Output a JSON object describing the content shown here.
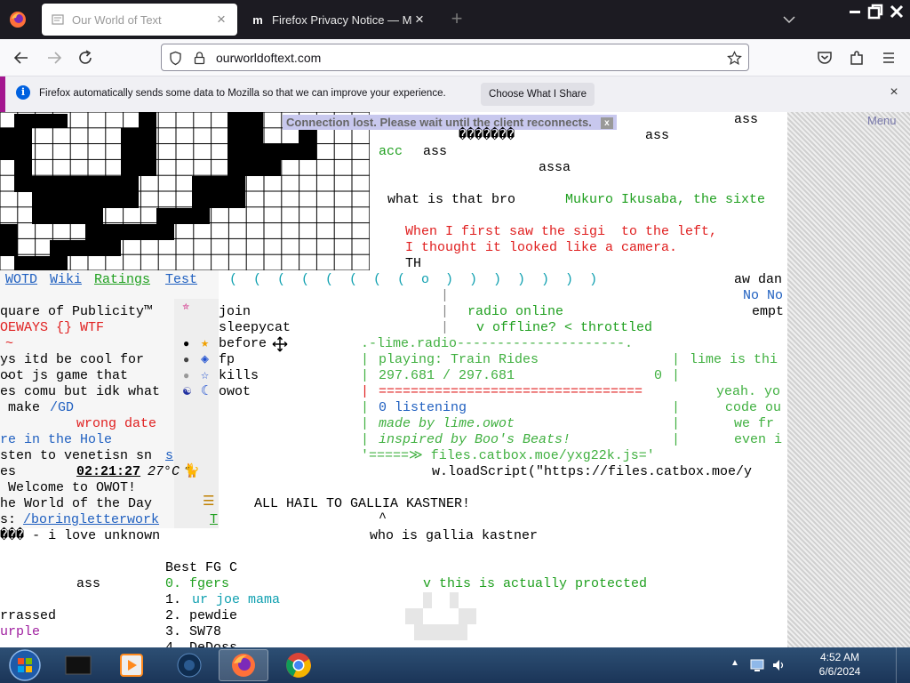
{
  "browser": {
    "tabs": [
      {
        "title": "Our World of Text",
        "active": true
      },
      {
        "title": "Firefox Privacy Notice — Mozilla",
        "active": false
      }
    ],
    "url": "ourworldoftext.com"
  },
  "notification": {
    "message": "Firefox automatically sends some data to Mozilla so that we can improve your experience.",
    "button": "Choose What I Share"
  },
  "owot": {
    "connection_banner": "Connection lost. Please wait until the client reconnects.",
    "connection_close": "x",
    "menu": "Menu",
    "links": {
      "wotd": "WOTD",
      "wiki": "Wiki",
      "ratings": "Ratings",
      "test": "Test"
    },
    "lines": {
      "ass_top_right": "ass",
      "question_marks": "�������",
      "ass2": "ass",
      "acc": "acc",
      "ass3": "ass",
      "assa": "assa",
      "what_is_that": "what is that bro",
      "mukuro": "Mukuro Ikusaba, the sixte",
      "when_first": "When I first saw the sigi  to the left,",
      "thought_camera": "I thought it looked like a camera.",
      "th": "TH",
      "parens": "(  (  (  (  (  (  (  (  o  )  )  )  )  )  )  )",
      "aw_dan": "aw dan",
      "no_no": "No No",
      "empt": "empt",
      "square_publicity": "quare of Publicity™",
      "deways": "OEWAYS {} WTF",
      "tilde": "~",
      "ys_itd": "ys itd be cool for",
      "ot_js": "o̴ot js game that",
      "es_comu": "es comu but idk what",
      "make": " make",
      "gd": "/GD",
      "wrong_date": "wrong date",
      "re_in_hole": "re in the Hole",
      "sten": "sten to venetisn sn",
      "sten_s": "s",
      "es": "es",
      "time": "02:21:27",
      "time_suffix": "27°C",
      "welcome": " Welcome to OWOT!",
      "world_day": "he World of the Day",
      "s_prefix": "s: ",
      "boring": "/boringletterwork",
      "t_link": "T",
      "love_unknown": "��� - i love unknown",
      "join": "join",
      "sleepycat": "sleepycat",
      "before": "before",
      "fp": "fp",
      "kills": "kills",
      "owot": "owot",
      "radio_online": "radio online",
      "offline": "v offline? < throttled",
      "pipe": "|",
      "lime_radio_top": ".-lime.radio---------------------.",
      "playing": "playing: Train Rides",
      "time_progress": "297.681 / 297.681",
      "zero": "0",
      "bar": "=================================",
      "listening": "0 listening",
      "made_by": "made by lime.owot",
      "inspired": "inspired by Boo's Beats!",
      "files_arrow": "'=====≫ files.catbox.moe/yxg22k.js='",
      "lime_this": "lime is thi",
      "yeah_yo": "yeah. yo",
      "code_ou": "code ou",
      "we_fr": "we fr",
      "even_i": "even i",
      "loadscript": "w.loadScript(\"https://files.catbox.moe/y",
      "all_hail": "ALL HAIL TO GALLIA KASTNER!",
      "caret": "^",
      "who_gallia": "who is gallia kastner",
      "best_fg": "Best FG C",
      "ass_left": "ass",
      "fgers": "0. fgers",
      "protected": "v this is actually protected",
      "ur_joe_num": "1. ",
      "ur_joe": "ur joe mama",
      "rrassed": "rrassed",
      "pewdie": "2. pewdie",
      "urple": "urple",
      "sw78": "3. SW78",
      "dedoss": "4. DeDoss"
    }
  },
  "taskbar": {
    "time": "4:52 AM",
    "date": "6/6/2024"
  },
  "colors": {
    "tabstrip": "#1c1b22",
    "green_text": "#20a020",
    "red_text": "#e02020",
    "link_blue": "#2060c0"
  }
}
